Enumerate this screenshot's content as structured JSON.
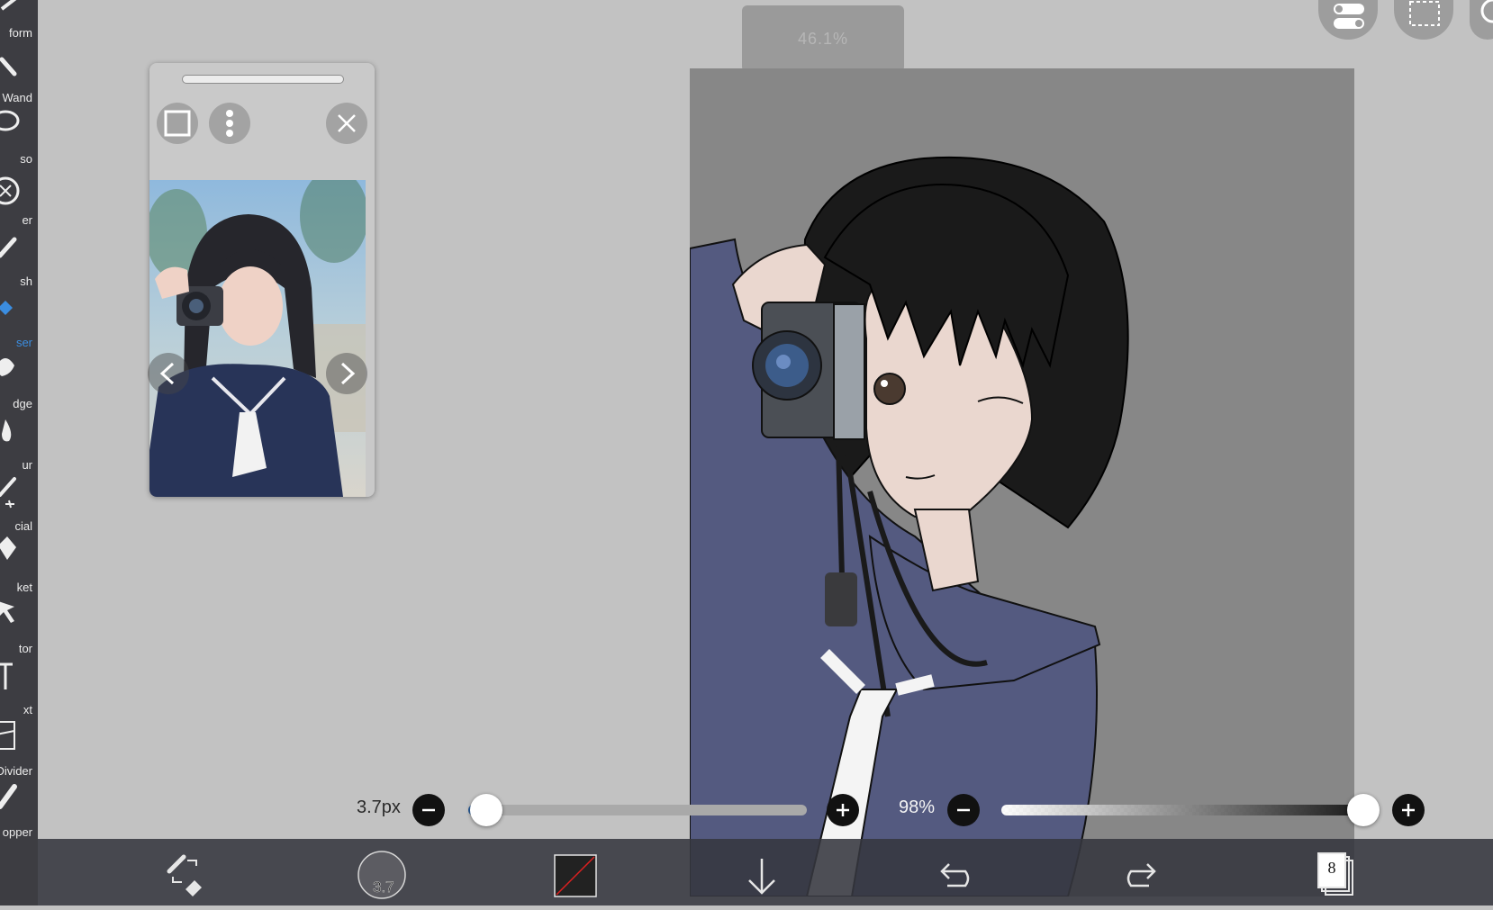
{
  "toolbar": {
    "tools": [
      {
        "label": "form",
        "icon": "transform-icon"
      },
      {
        "label": "Wand",
        "icon": "magic-wand-icon"
      },
      {
        "label": "so",
        "icon": "lasso-icon"
      },
      {
        "label": "er",
        "icon": "filter-icon"
      },
      {
        "label": "sh",
        "icon": "brush-icon"
      },
      {
        "label": "ser",
        "icon": "eraser-icon",
        "active": true
      },
      {
        "label": "dge",
        "icon": "smudge-icon"
      },
      {
        "label": "ur",
        "icon": "blur-icon"
      },
      {
        "label": "cial",
        "icon": "special-pen-icon"
      },
      {
        "label": "ket",
        "icon": "bucket-icon"
      },
      {
        "label": "tor",
        "icon": "selector-icon"
      },
      {
        "label": "xt",
        "icon": "text-icon"
      },
      {
        "label": "Divider",
        "icon": "frame-divider-icon"
      },
      {
        "label": "opper",
        "icon": "eyedropper-icon"
      }
    ]
  },
  "zoom": {
    "label": "46.1%"
  },
  "brush": {
    "size_label": "3.7px",
    "size_value": 3.7
  },
  "opacity": {
    "label": "98%",
    "value": 98
  },
  "bottom_bar": {
    "brush_preview_label": "3.7",
    "layer_count": "8",
    "items": [
      "swap-tools-icon",
      "brush-size-icon",
      "color-swatch",
      "download-icon",
      "undo-icon",
      "redo-icon",
      "layers-icon"
    ]
  },
  "colors": {
    "accent": "#3b8de0",
    "toolbar_bg": "#3d3d42",
    "workspace_bg": "#c2c2c2",
    "canvas_bg": "#878787",
    "uniform_blue": "#545a80",
    "hair": "#1a1a1a",
    "skin": "#ead7cf"
  }
}
